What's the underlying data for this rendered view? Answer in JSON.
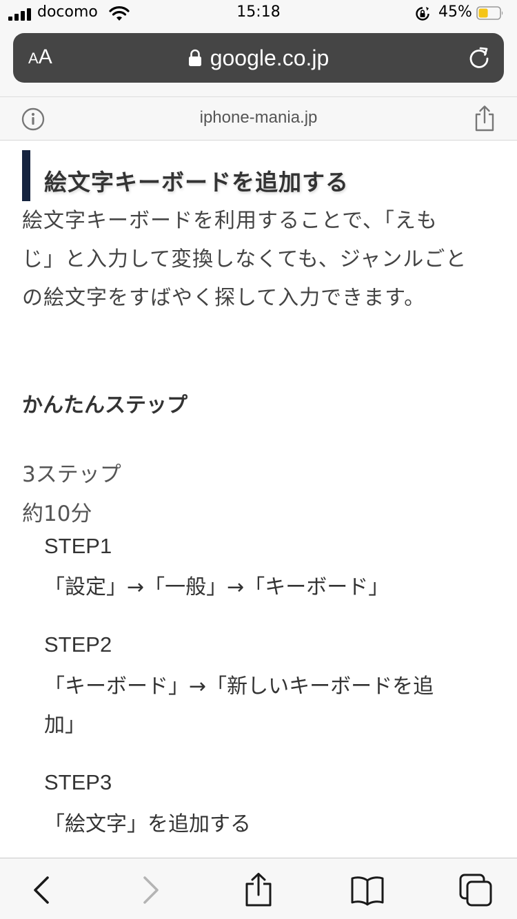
{
  "status_bar": {
    "carrier": "docomo",
    "time": "15:18",
    "battery_percent": "45%",
    "battery_level": 0.45,
    "battery_color": "#f5c518"
  },
  "browser": {
    "aa_small": "A",
    "aa_big": "A",
    "url": "google.co.jp",
    "site_domain": "iphone-mania.jp"
  },
  "article": {
    "heading": "絵文字キーボードを追加する",
    "heading_bar_color": "#16243f",
    "intro_lines": [
      "絵文字キーボードを利用することで、「えも",
      "じ」と入力して変換しなくても、ジャンルごと",
      "の絵文字をすばやく探して入力できます。"
    ],
    "steps_title": "かんたんステップ",
    "step_count": "3ステップ",
    "duration": "約10分",
    "steps": [
      {
        "label": "STEP1",
        "lines": [
          "「設定」→「一般」→「キーボード」"
        ]
      },
      {
        "label": "STEP2",
        "lines": [
          "「キーボード」→「新しいキーボードを追",
          "加」"
        ]
      },
      {
        "label": "STEP3",
        "lines": [
          "「絵文字」を追加する"
        ]
      }
    ]
  },
  "toolbar": {
    "icons": [
      "back-icon",
      "forward-icon",
      "share-icon",
      "bookmarks-icon",
      "tabs-icon"
    ]
  }
}
